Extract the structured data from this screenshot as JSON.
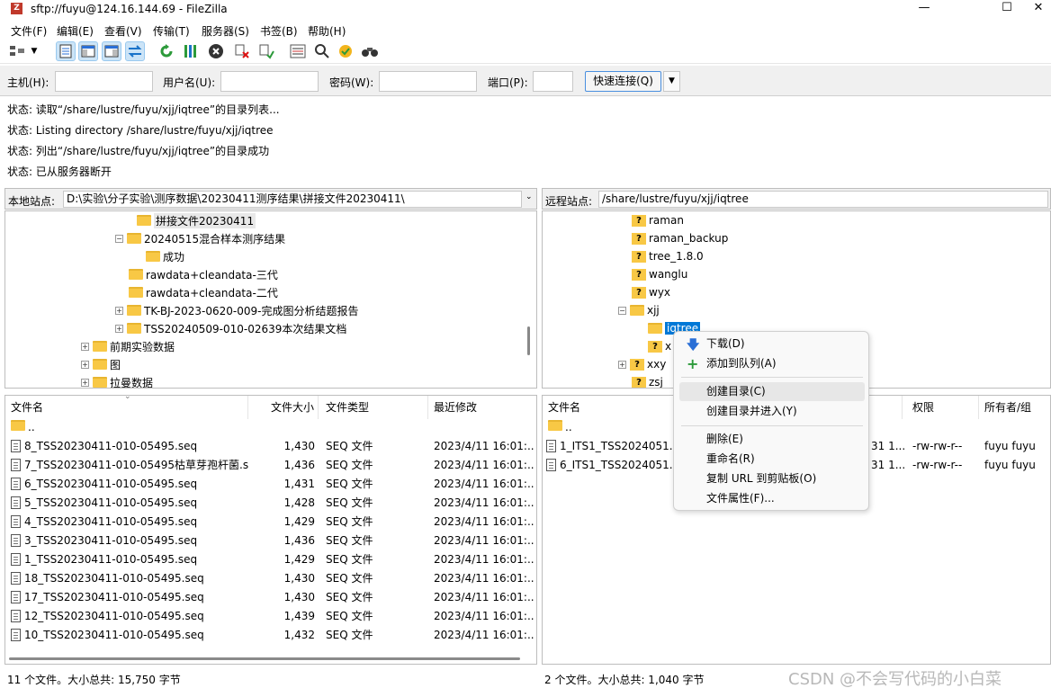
{
  "window": {
    "title": "sftp://fuyu@124.16.144.69 - FileZilla",
    "app_icon_glyph": "Z",
    "minimize_glyph": "—",
    "maximize_glyph": "☐",
    "close_glyph": "✕"
  },
  "menu": [
    "文件(F)",
    "编辑(E)",
    "查看(V)",
    "传输(T)",
    "服务器(S)",
    "书签(B)",
    "帮助(H)"
  ],
  "toolbar_icons": [
    "site-manager-icon",
    "dropdown-arrow-icon",
    "toggle-log-icon",
    "toggle-local-tree-icon",
    "toggle-remote-tree-icon",
    "toggle-queue-icon",
    "refresh-icon",
    "process-queue-icon",
    "cancel-icon",
    "disconnect-icon",
    "reconnect-icon",
    "filter-icon",
    "compare-icon",
    "sync-browse-icon",
    "find-icon"
  ],
  "quickconnect": {
    "host_label": "主机(H):",
    "user_label": "用户名(U):",
    "pass_label": "密码(W):",
    "port_label": "端口(P):",
    "host_value": "",
    "user_value": "",
    "pass_value": "",
    "port_value": "",
    "connect_button": "快速连接(Q)",
    "dropdown_glyph": "▼"
  },
  "log": [
    {
      "label": "状态:",
      "text": "读取“/share/lustre/fuyu/xjj/iqtree”的目录列表..."
    },
    {
      "label": "状态:",
      "text": "Listing directory /share/lustre/fuyu/xjj/iqtree"
    },
    {
      "label": "状态:",
      "text": "列出“/share/lustre/fuyu/xjj/iqtree”的目录成功"
    },
    {
      "label": "状态:",
      "text": "已从服务器断开"
    }
  ],
  "local": {
    "site_label": "本地站点:",
    "path": "D:\\实验\\分子实验\\测序数据\\20230411测序结果\\拼接文件20230411\\",
    "tree": [
      {
        "label": "拼接文件20230411",
        "expander": "",
        "selected": true
      },
      {
        "label": "20240515混合样本测序结果",
        "expander": "−"
      },
      {
        "label": "成功",
        "expander": ""
      },
      {
        "label": "rawdata+cleandata-三代",
        "expander": ""
      },
      {
        "label": "rawdata+cleandata-二代",
        "expander": ""
      },
      {
        "label": "TK-BJ-2023-0620-009-完成图分析结题报告",
        "expander": "+"
      },
      {
        "label": "TSS20240509-010-02639本次结果文档",
        "expander": "+"
      },
      {
        "label": "前期实验数据",
        "expander": "+"
      },
      {
        "label": "图",
        "expander": "+"
      },
      {
        "label": "拉曼数据",
        "expander": "+"
      }
    ],
    "columns": [
      "文件名",
      "文件大小",
      "文件类型",
      "最近修改"
    ],
    "parent_dir": "..",
    "files": [
      {
        "name": "8_TSS20230411-010-05495.seq",
        "size": "1,430",
        "type": "SEQ 文件",
        "modified": "2023/4/11 16:01:..."
      },
      {
        "name": "7_TSS20230411-010-05495枯草芽孢杆菌.s...",
        "size": "1,436",
        "type": "SEQ 文件",
        "modified": "2023/4/11 16:01:..."
      },
      {
        "name": "6_TSS20230411-010-05495.seq",
        "size": "1,431",
        "type": "SEQ 文件",
        "modified": "2023/4/11 16:01:..."
      },
      {
        "name": "5_TSS20230411-010-05495.seq",
        "size": "1,428",
        "type": "SEQ 文件",
        "modified": "2023/4/11 16:01:..."
      },
      {
        "name": "4_TSS20230411-010-05495.seq",
        "size": "1,429",
        "type": "SEQ 文件",
        "modified": "2023/4/11 16:01:..."
      },
      {
        "name": "3_TSS20230411-010-05495.seq",
        "size": "1,436",
        "type": "SEQ 文件",
        "modified": "2023/4/11 16:01:..."
      },
      {
        "name": "1_TSS20230411-010-05495.seq",
        "size": "1,429",
        "type": "SEQ 文件",
        "modified": "2023/4/11 16:01:..."
      },
      {
        "name": "18_TSS20230411-010-05495.seq",
        "size": "1,430",
        "type": "SEQ 文件",
        "modified": "2023/4/11 16:01:..."
      },
      {
        "name": "17_TSS20230411-010-05495.seq",
        "size": "1,430",
        "type": "SEQ 文件",
        "modified": "2023/4/11 16:01:..."
      },
      {
        "name": "12_TSS20230411-010-05495.seq",
        "size": "1,439",
        "type": "SEQ 文件",
        "modified": "2023/4/11 16:01:..."
      },
      {
        "name": "10_TSS20230411-010-05495.seq",
        "size": "1,432",
        "type": "SEQ 文件",
        "modified": "2023/4/11 16:01:..."
      }
    ],
    "status": "11 个文件。大小总共: 15,750 字节"
  },
  "remote": {
    "site_label": "远程站点:",
    "path": "/share/lustre/fuyu/xjj/iqtree",
    "tree": [
      {
        "label": "raman",
        "kind": "q",
        "expander": ""
      },
      {
        "label": "raman_backup",
        "kind": "q",
        "expander": ""
      },
      {
        "label": "tree_1.8.0",
        "kind": "q",
        "expander": ""
      },
      {
        "label": "wanglu",
        "kind": "q",
        "expander": ""
      },
      {
        "label": "wyx",
        "kind": "q",
        "expander": ""
      },
      {
        "label": "xjj",
        "kind": "folder",
        "expander": "−"
      },
      {
        "label": "iqtree",
        "kind": "folder",
        "expander": "",
        "selected": true
      },
      {
        "label": "x",
        "kind": "q",
        "expander": ""
      },
      {
        "label": "xxy",
        "kind": "q",
        "expander": "+"
      },
      {
        "label": "zsj",
        "kind": "q",
        "expander": ""
      }
    ],
    "columns": [
      "文件名",
      "权限",
      "所有者/组"
    ],
    "parent_dir": "..",
    "files": [
      {
        "name": "1_ITS1_TSS2024051...",
        "modified_fragment": "31 1...",
        "perm": "-rw-rw-r--",
        "owner": "fuyu fuyu"
      },
      {
        "name": "6_ITS1_TSS2024051...",
        "modified_fragment": "31 1...",
        "perm": "-rw-rw-r--",
        "owner": "fuyu fuyu"
      }
    ],
    "status": "2 个文件。大小总共: 1,040 字节"
  },
  "context_menu": [
    {
      "label": "下载(D)",
      "icon": "download-arrow-icon",
      "glyph": "🡇"
    },
    {
      "label": "添加到队列(A)",
      "icon": "add-to-queue-icon",
      "glyph": "+"
    },
    {
      "sep": true
    },
    {
      "label": "创建目录(C)",
      "highlight": true
    },
    {
      "label": "创建目录并进入(Y)"
    },
    {
      "sep": true
    },
    {
      "label": "删除(E)"
    },
    {
      "label": "重命名(R)"
    },
    {
      "label": "复制 URL 到剪贴板(O)"
    },
    {
      "label": "文件属性(F)..."
    }
  ],
  "watermark": "CSDN @不会写代码的小白菜",
  "colors": {
    "accent": "#0078d7",
    "folder": "#f8c845",
    "selection": "#cce8ff"
  }
}
